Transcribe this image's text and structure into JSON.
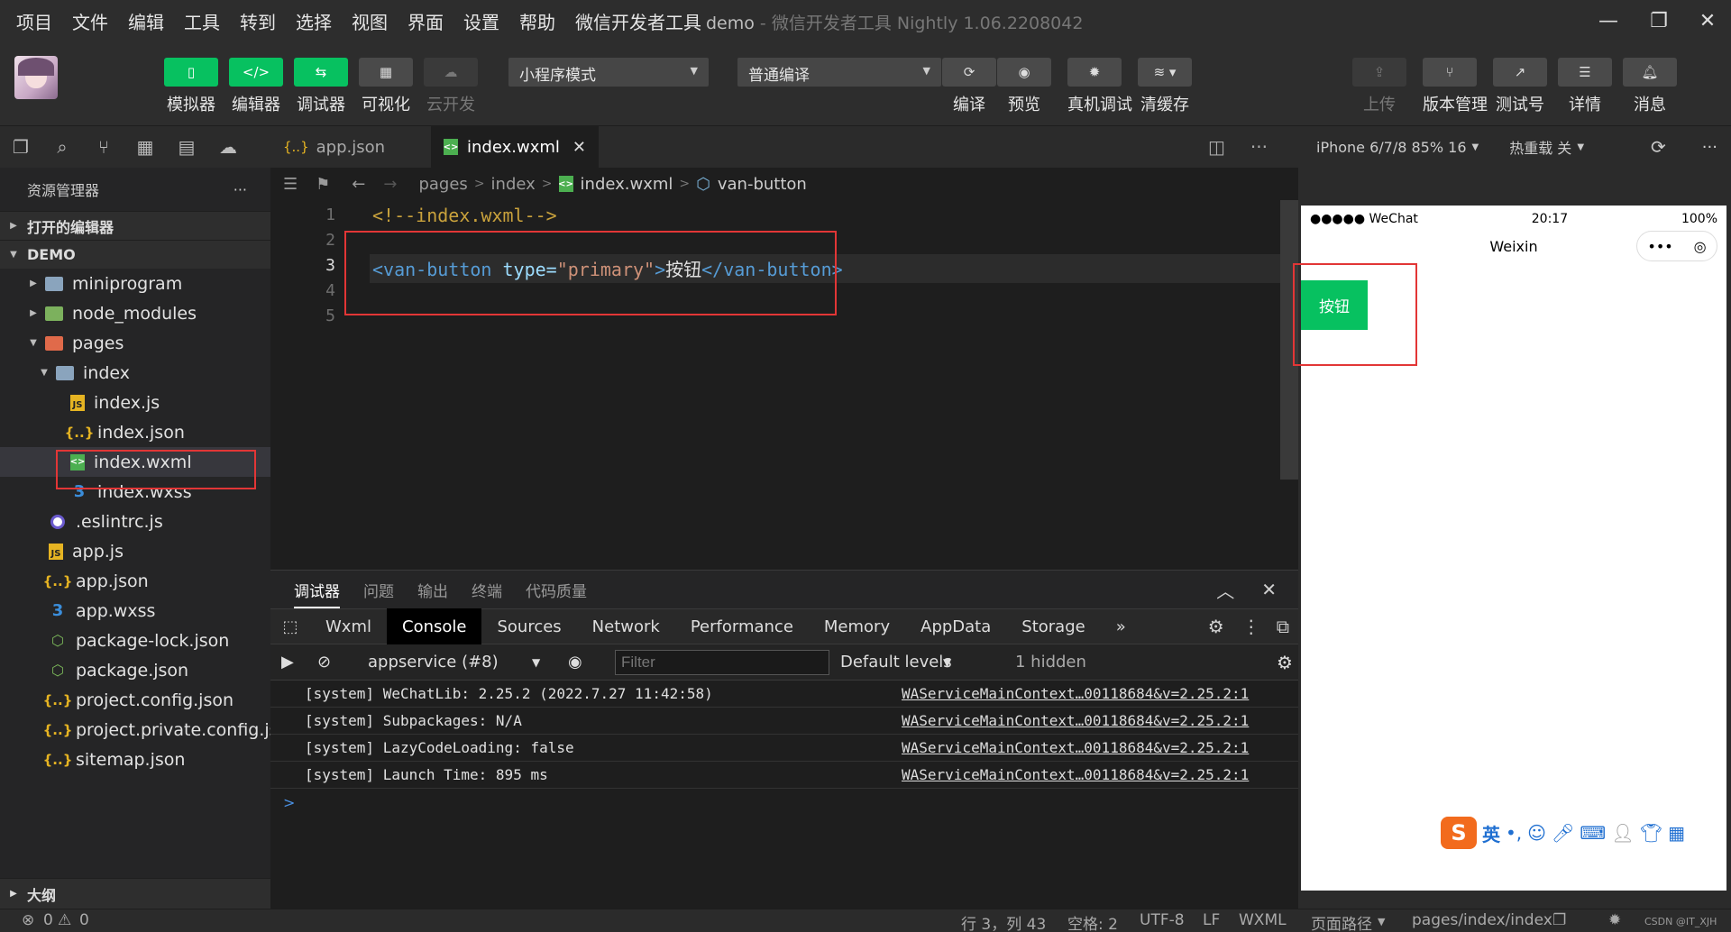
{
  "menu": [
    "项目",
    "文件",
    "编辑",
    "工具",
    "转到",
    "选择",
    "视图",
    "界面",
    "设置",
    "帮助",
    "微信开发者工具"
  ],
  "window": {
    "title_project": "demo",
    "title_app": " - 微信开发者工具 Nightly 1.06.2208042"
  },
  "toolbar": {
    "simulator": "模拟器",
    "editor": "编辑器",
    "debugger": "调试器",
    "visual": "可视化",
    "cloud": "云开发",
    "mode_select": "小程序模式",
    "compile_select": "普通编译",
    "compile": "编译",
    "preview": "预览",
    "device_debug": "真机调试",
    "clear_cache": "清缓存",
    "upload": "上传",
    "version": "版本管理",
    "test": "测试号",
    "details": "详情",
    "messages": "消息"
  },
  "sidebar": {
    "title": "资源管理器",
    "open_editors": "打开的编辑器",
    "project": "DEMO",
    "items": [
      {
        "label": "miniprogram"
      },
      {
        "label": "node_modules"
      },
      {
        "label": "pages"
      },
      {
        "label": "index"
      },
      {
        "label": "index.js"
      },
      {
        "label": "index.json"
      },
      {
        "label": "index.wxml"
      },
      {
        "label": "index.wxss"
      },
      {
        "label": ".eslintrc.js"
      },
      {
        "label": "app.js"
      },
      {
        "label": "app.json"
      },
      {
        "label": "app.wxss"
      },
      {
        "label": "package-lock.json"
      },
      {
        "label": "package.json"
      },
      {
        "label": "project.config.json"
      },
      {
        "label": "project.private.config.js..."
      },
      {
        "label": "sitemap.json"
      }
    ],
    "outline": "大纲",
    "problems_errors": "0",
    "problems_warnings": "0"
  },
  "tabs": [
    {
      "label": "app.json"
    },
    {
      "label": "index.wxml"
    }
  ],
  "breadcrumb": {
    "p1": "pages",
    "p2": "index",
    "p3": "index.wxml",
    "p4": "van-button"
  },
  "code": {
    "lines": [
      "1",
      "2",
      "3",
      "4",
      "5"
    ],
    "line1": "<!--index.wxml-->",
    "tag_open": "<van-button",
    "attr": " type=",
    "str": "\"primary\"",
    "gt": ">",
    "text": "按钮",
    "tag_close": "</van-button",
    "gt2": ">"
  },
  "panel": {
    "tabs": [
      "调试器",
      "问题",
      "输出",
      "终端",
      "代码质量"
    ],
    "devtools_tabs": [
      "Wxml",
      "Console",
      "Sources",
      "Network",
      "Performance",
      "Memory",
      "AppData",
      "Storage"
    ],
    "context": "appservice (#8)",
    "filter_placeholder": "Filter",
    "levels": "Default levels",
    "hidden": "1 hidden",
    "logs": [
      {
        "text": "[system] WeChatLib: 2.25.2 (2022.7.27 11:42:58)",
        "src": "WAServiceMainContext…00118684&v=2.25.2:1"
      },
      {
        "text": "[system] Subpackages: N/A",
        "src": "WAServiceMainContext…00118684&v=2.25.2:1"
      },
      {
        "text": "[system] LazyCodeLoading: false",
        "src": "WAServiceMainContext…00118684&v=2.25.2:1"
      },
      {
        "text": "[system] Launch Time: 895 ms",
        "src": "WAServiceMainContext…00118684&v=2.25.2:1"
      }
    ],
    "prompt": ">"
  },
  "simulator": {
    "device": "iPhone 6/7/8 85% 16",
    "hot_reload": "热重载 关",
    "carrier": "●●●●● WeChat",
    "time": "20:17",
    "battery": "100%",
    "nav_title": "Weixin",
    "button_text": "按钮",
    "ime_lang": "英"
  },
  "status": {
    "position": "行 3，列 43",
    "spaces": "空格: 2",
    "encoding": "UTF-8",
    "eol": "LF",
    "language": "WXML",
    "page_path_label": "页面路径",
    "page_path": "pages/index/index",
    "watermark": "CSDN @IT_XJH"
  },
  "colors": {
    "brand_green": "#07c160",
    "highlight_red": "#e23636"
  }
}
